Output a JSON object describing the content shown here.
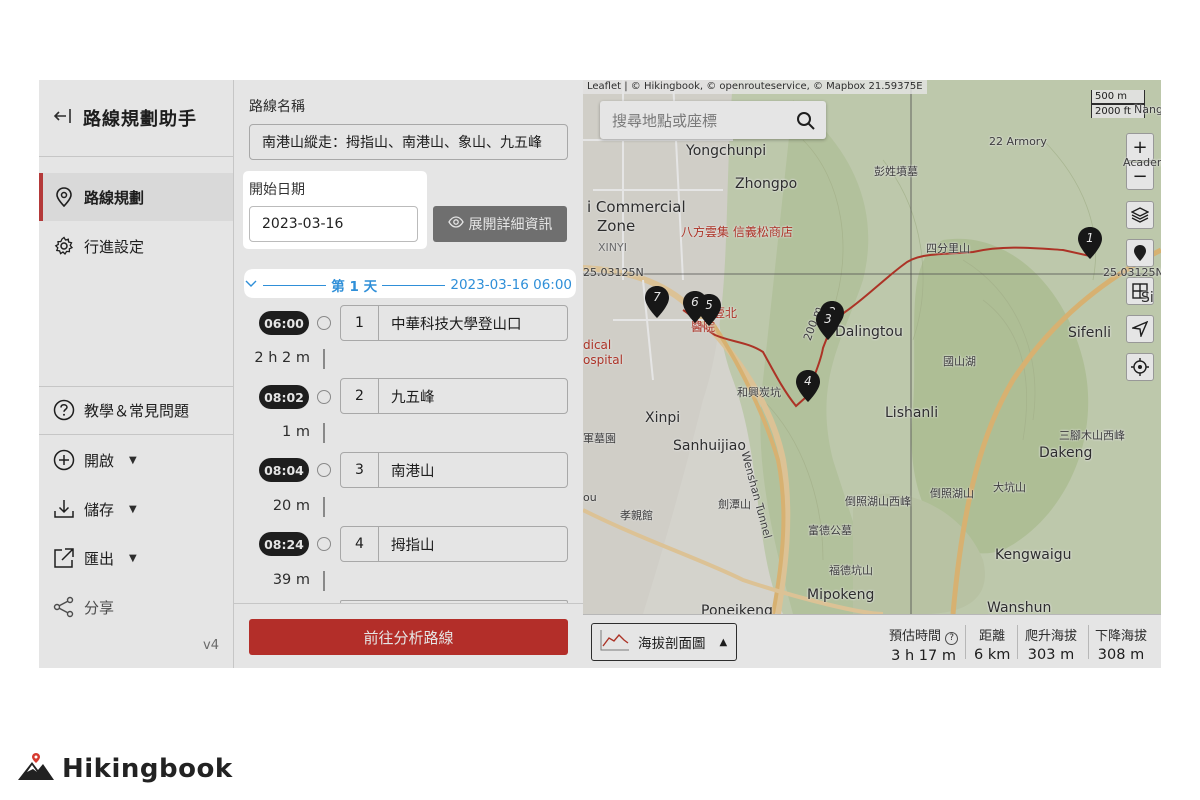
{
  "sidebar": {
    "title": "路線規劃助手",
    "back_icon": "back-arrow-icon",
    "items": [
      {
        "label": "路線規劃",
        "icon": "location-pin-icon",
        "active": true
      },
      {
        "label": "行進設定",
        "icon": "gear-icon",
        "active": false
      }
    ],
    "help": {
      "label": "教學＆常見問題",
      "icon": "question-circle-icon"
    },
    "actions": [
      {
        "label": "開啟",
        "icon": "plus-circle-icon"
      },
      {
        "label": "儲存",
        "icon": "download-icon"
      },
      {
        "label": "匯出",
        "icon": "external-link-icon"
      }
    ],
    "share": {
      "label": "分享",
      "icon": "share-icon"
    },
    "version": "v4"
  },
  "planner": {
    "route_name_label": "路線名稱",
    "route_name_value": "南港山縱走：拇指山、南港山、象山、九五峰",
    "start_date_label": "開始日期",
    "start_date_value": "2023-03-16",
    "detail_button": "展開詳細資訊",
    "day_label": "第 1 天",
    "day_datetime": "2023-03-16 06:00",
    "waypoints": [
      {
        "time": "06:00",
        "index": "1",
        "name": "中華科技大學登山口"
      },
      {
        "time": "08:02",
        "index": "2",
        "name": "九五峰"
      },
      {
        "time": "08:04",
        "index": "3",
        "name": "南港山"
      },
      {
        "time": "08:24",
        "index": "4",
        "name": "拇指山"
      }
    ],
    "durations": [
      "2 h 2 m",
      "1 m",
      "20 m",
      "39 m"
    ],
    "analyze_button": "前往分析路線"
  },
  "map": {
    "attribution": "Leaflet | © Hikingbook, © openrouteservice, © Mapbox 21.59375E",
    "search_placeholder": "搜尋地點或座標",
    "scale_metric": "500 m",
    "scale_imperial": "2000 ft",
    "coord_lat_left": "25.03125N",
    "coord_lat_right": "25.03125N",
    "labels": [
      "Yongchunpi",
      "Zhongpo",
      "i Commercial",
      "Zone",
      "XINYI",
      "Dalingtou",
      "Xinpi",
      "Sanhuijiao",
      "Lishanli",
      "Sifenli",
      "Dakeng",
      "Kengwaigu",
      "Mipokeng",
      "Wanshun",
      "Ponejkeng",
      "Wenshan Tunnel",
      "Nang",
      "Academ",
      "Si",
      "ou"
    ],
    "red_labels": [
      "八方雲集 信義松商店",
      "醫院",
      "dical",
      "ospital",
      "壹北"
    ],
    "small_labels": [
      "彭姓墳墓",
      "四分里山",
      "和興炭坑",
      "富德公墓",
      "福德坑山",
      "倒照湖山西峰",
      "倒照湖山",
      "大坑山",
      "三腳木山西峰",
      "孝親館",
      "劍潭山",
      "軍墓園",
      "國山湖",
      "22 Armory",
      "200 m"
    ],
    "pins": [
      "1",
      "2",
      "3",
      "4",
      "5",
      "6",
      "7"
    ],
    "elevation_button": "海拔剖面圖",
    "stats": [
      {
        "key": "預估時間",
        "value": "3 h 17 m"
      },
      {
        "key": "距離",
        "value": "6 km"
      },
      {
        "key": "爬升海拔",
        "value": "303 m"
      },
      {
        "key": "下降海拔",
        "value": "308 m"
      }
    ],
    "controls": [
      "zoom-in-icon",
      "zoom-out-icon",
      "layers-icon",
      "marker-icon",
      "grid-icon",
      "navigate-icon",
      "locate-icon"
    ],
    "colors": {
      "route": "#c0392b",
      "dim_overlay": "rgba(0,0,0,0.10)",
      "accent": "#2f8fd8",
      "danger": "#c8342e"
    }
  },
  "brand": {
    "name": "Hikingbook"
  }
}
